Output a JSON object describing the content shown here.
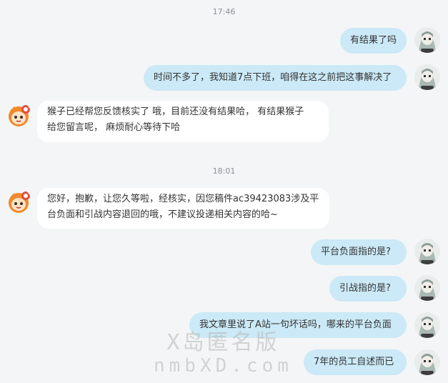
{
  "timestamps": [
    "17:46",
    "18:01"
  ],
  "messages": [
    {
      "side": "right",
      "lines": [
        "有结果了吗"
      ]
    },
    {
      "side": "right",
      "lines": [
        "时间不多了，我知道7点下班，咱得在这之前把这事解决了"
      ]
    },
    {
      "side": "left",
      "lines": [
        "猴子已经帮您反馈核实了  哦，目前还没有结果哈，  有结果猴子",
        "给您留言呢，  麻烦耐心等待下哈"
      ]
    },
    {
      "side": "left",
      "lines": [
        "您好，抱歉，让您久等啦，经核实，因您稿件ac39423083涉及平",
        "台负面和引战内容退回的哦，不建议投递相关内容的哈~"
      ]
    },
    {
      "side": "right",
      "lines": [
        "平台负面指的是?"
      ]
    },
    {
      "side": "right",
      "lines": [
        "引战指的是?"
      ]
    },
    {
      "side": "right",
      "lines": [
        "我文章里说了A站一句坏话吗，哪来的平台负面"
      ]
    },
    {
      "side": "right",
      "lines": [
        "7年的员工自述而已"
      ]
    }
  ],
  "watermark": {
    "line1": "X岛匿名版",
    "line2": "nmbXD.com"
  },
  "colors": {
    "background": "#f4f5f7",
    "bubble_right": "#cbe9f7",
    "bubble_left": "#ffffff"
  },
  "icons": {
    "user_avatar": "gray-haired-character-avatar-icon",
    "agent_avatar": "orange-haired-mascot-avatar-icon"
  }
}
